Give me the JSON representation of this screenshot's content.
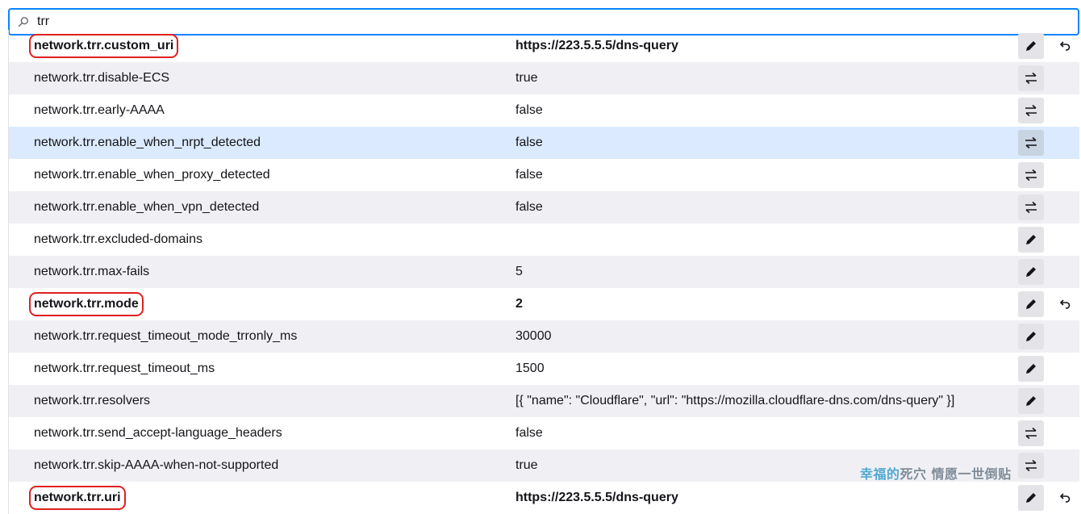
{
  "search": {
    "value": "trr",
    "icon": "search-icon"
  },
  "rows": [
    {
      "name": "network.trr.custom_uri",
      "value": "https://223.5.5.5/dns-query",
      "action": "edit",
      "modified": true
    },
    {
      "name": "network.trr.disable-ECS",
      "value": "true",
      "action": "toggle",
      "modified": false
    },
    {
      "name": "network.trr.early-AAAA",
      "value": "false",
      "action": "toggle",
      "modified": false
    },
    {
      "name": "network.trr.enable_when_nrpt_detected",
      "value": "false",
      "action": "toggle",
      "modified": false
    },
    {
      "name": "network.trr.enable_when_proxy_detected",
      "value": "false",
      "action": "toggle",
      "modified": false
    },
    {
      "name": "network.trr.enable_when_vpn_detected",
      "value": "false",
      "action": "toggle",
      "modified": false
    },
    {
      "name": "network.trr.excluded-domains",
      "value": "",
      "action": "edit",
      "modified": false
    },
    {
      "name": "network.trr.max-fails",
      "value": "5",
      "action": "edit",
      "modified": false
    },
    {
      "name": "network.trr.mode",
      "value": "2",
      "action": "edit",
      "modified": true
    },
    {
      "name": "network.trr.request_timeout_mode_trronly_ms",
      "value": "30000",
      "action": "edit",
      "modified": false
    },
    {
      "name": "network.trr.request_timeout_ms",
      "value": "1500",
      "action": "edit",
      "modified": false
    },
    {
      "name": "network.trr.resolvers",
      "value": "[{ \"name\": \"Cloudflare\", \"url\": \"https://mozilla.cloudflare-dns.com/dns-query\" }]",
      "action": "edit",
      "modified": false
    },
    {
      "name": "network.trr.send_accept-language_headers",
      "value": "false",
      "action": "toggle",
      "modified": false
    },
    {
      "name": "network.trr.skip-AAAA-when-not-supported",
      "value": "true",
      "action": "toggle",
      "modified": false
    },
    {
      "name": "network.trr.uri",
      "value": "https://223.5.5.5/dns-query",
      "action": "edit",
      "modified": true
    }
  ],
  "watermark": {
    "part1": "幸福的",
    "part2": "死穴 情愿一世倒贴"
  },
  "colors": {
    "accent": "#0a84ff",
    "highlight": "#e02020",
    "hover_row": "#dbeafe",
    "stripe": "#f0f0f4"
  }
}
